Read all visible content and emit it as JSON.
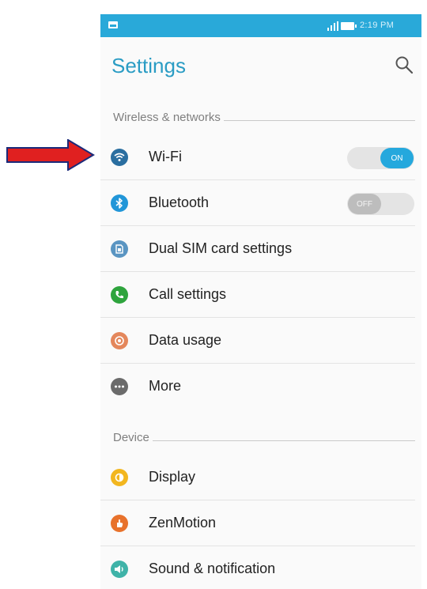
{
  "status_bar": {
    "time": "2:19 PM"
  },
  "header": {
    "title": "Settings"
  },
  "sections": {
    "wireless": {
      "label": "Wireless & networks"
    },
    "device": {
      "label": "Device"
    }
  },
  "items": {
    "wifi": {
      "label": "Wi-Fi",
      "toggle": "ON"
    },
    "bluetooth": {
      "label": "Bluetooth",
      "toggle": "OFF"
    },
    "dual_sim": {
      "label": "Dual SIM card settings"
    },
    "call": {
      "label": "Call settings"
    },
    "data_usage": {
      "label": "Data usage"
    },
    "more": {
      "label": "More"
    },
    "display": {
      "label": "Display"
    },
    "zenmotion": {
      "label": "ZenMotion"
    },
    "sound": {
      "label": "Sound & notification"
    }
  },
  "colors": {
    "accent": "#29a9d9",
    "toggle_on": "#25a8dd",
    "annotation_arrow": "#e02020"
  },
  "icons": {
    "wifi": "wifi-icon",
    "bluetooth": "bluetooth-icon",
    "dual_sim": "sim-card-icon",
    "call": "phone-icon",
    "data_usage": "data-usage-icon",
    "more": "more-icon",
    "display": "display-icon",
    "zenmotion": "zenmotion-icon",
    "sound": "sound-icon",
    "search": "search-icon"
  }
}
